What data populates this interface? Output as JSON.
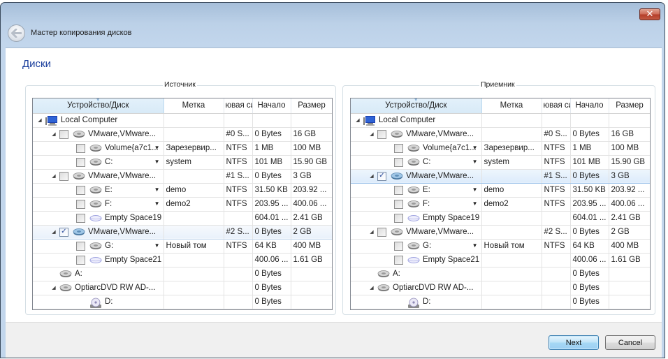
{
  "window": {
    "title": "Мастер копирования дисков",
    "close_icon": "close-x-icon",
    "back_icon": "back-arrow-icon"
  },
  "page": {
    "heading": "Диски"
  },
  "columns": [
    "Устройство/Диск",
    "Метка",
    "ювая си",
    "Начало",
    "Размер"
  ],
  "source": {
    "label": "Источник",
    "rows": [
      {
        "level": 0,
        "expander": true,
        "checkbox": false,
        "checked": false,
        "icon": "computer-icon",
        "name": "Local Computer",
        "dropdown": false,
        "label": "",
        "fs": "",
        "start": "",
        "size": "",
        "selected": false
      },
      {
        "level": 1,
        "expander": true,
        "checkbox": true,
        "checked": false,
        "icon": "hard-disk-icon",
        "name": "VMware,VMware...",
        "dropdown": false,
        "label": "",
        "fs": "#0 S...",
        "start": "0 Bytes",
        "size": "16 GB",
        "selected": false
      },
      {
        "level": 2,
        "expander": false,
        "checkbox": true,
        "checked": false,
        "icon": "hard-disk-icon",
        "name": "Volume{a7c1...",
        "dropdown": true,
        "label": "Зарезервир...",
        "fs": "NTFS",
        "start": "1 MB",
        "size": "100 MB",
        "selected": false
      },
      {
        "level": 2,
        "expander": false,
        "checkbox": true,
        "checked": false,
        "icon": "hard-disk-icon",
        "name": "C:",
        "dropdown": true,
        "label": "system",
        "fs": "NTFS",
        "start": "101 MB",
        "size": "15.90 GB",
        "selected": false
      },
      {
        "level": 1,
        "expander": true,
        "checkbox": true,
        "checked": false,
        "icon": "hard-disk-icon",
        "name": "VMware,VMware...",
        "dropdown": false,
        "label": "",
        "fs": "#1 S...",
        "start": "0 Bytes",
        "size": "3 GB",
        "selected": false
      },
      {
        "level": 2,
        "expander": false,
        "checkbox": true,
        "checked": false,
        "icon": "hard-disk-icon",
        "name": "E:",
        "dropdown": true,
        "label": "demo",
        "fs": "NTFS",
        "start": "31.50 KB",
        "size": "203.92 ...",
        "selected": false
      },
      {
        "level": 2,
        "expander": false,
        "checkbox": true,
        "checked": false,
        "icon": "hard-disk-icon",
        "name": "F:",
        "dropdown": true,
        "label": "demo2",
        "fs": "NTFS",
        "start": "203.95 ...",
        "size": "400.06 ...",
        "selected": false
      },
      {
        "level": 2,
        "expander": false,
        "checkbox": true,
        "checked": false,
        "icon": "empty-space-icon",
        "name": "Empty Space19",
        "dropdown": false,
        "label": "",
        "fs": "",
        "start": "604.01 ...",
        "size": "2.41 GB",
        "selected": false
      },
      {
        "level": 1,
        "expander": true,
        "checkbox": true,
        "checked": true,
        "icon": "hard-disk-selected-icon",
        "name": "VMware,VMware...",
        "dropdown": false,
        "label": "",
        "fs": "#2 S...",
        "start": "0 Bytes",
        "size": "2 GB",
        "selected": true
      },
      {
        "level": 2,
        "expander": false,
        "checkbox": true,
        "checked": false,
        "icon": "hard-disk-icon",
        "name": "G:",
        "dropdown": true,
        "label": "Новый том",
        "fs": "NTFS",
        "start": "64 KB",
        "size": "400 MB",
        "selected": false
      },
      {
        "level": 2,
        "expander": false,
        "checkbox": true,
        "checked": false,
        "icon": "empty-space-icon",
        "name": "Empty Space21",
        "dropdown": false,
        "label": "",
        "fs": "",
        "start": "400.06 ...",
        "size": "1.61 GB",
        "selected": false
      },
      {
        "level": 1,
        "expander": false,
        "checkbox": false,
        "checked": false,
        "icon": "hard-disk-icon",
        "name": "A:",
        "dropdown": false,
        "label": "",
        "fs": "",
        "start": "0 Bytes",
        "size": "",
        "selected": false
      },
      {
        "level": 1,
        "expander": true,
        "checkbox": false,
        "checked": false,
        "icon": "hard-disk-icon",
        "name": "OptiarcDVD RW AD-...",
        "dropdown": false,
        "label": "",
        "fs": "",
        "start": "0 Bytes",
        "size": "",
        "selected": false
      },
      {
        "level": 2,
        "expander": false,
        "checkbox": false,
        "checked": false,
        "icon": "optical-drive-icon",
        "name": "D:",
        "dropdown": false,
        "label": "",
        "fs": "",
        "start": "0 Bytes",
        "size": "",
        "selected": false
      }
    ]
  },
  "target": {
    "label": "Приемник",
    "rows": [
      {
        "level": 0,
        "expander": true,
        "checkbox": false,
        "checked": false,
        "icon": "computer-icon",
        "name": "Local Computer",
        "dropdown": false,
        "label": "",
        "fs": "",
        "start": "",
        "size": "",
        "selected": false
      },
      {
        "level": 1,
        "expander": true,
        "checkbox": true,
        "checked": false,
        "icon": "hard-disk-icon",
        "name": "VMware,VMware...",
        "dropdown": false,
        "label": "",
        "fs": "#0 S...",
        "start": "0 Bytes",
        "size": "16 GB",
        "selected": false
      },
      {
        "level": 2,
        "expander": false,
        "checkbox": true,
        "checked": false,
        "icon": "hard-disk-icon",
        "name": "Volume{a7c1...",
        "dropdown": true,
        "label": "Зарезервир...",
        "fs": "NTFS",
        "start": "1 MB",
        "size": "100 MB",
        "selected": false
      },
      {
        "level": 2,
        "expander": false,
        "checkbox": true,
        "checked": false,
        "icon": "hard-disk-icon",
        "name": "C:",
        "dropdown": true,
        "label": "system",
        "fs": "NTFS",
        "start": "101 MB",
        "size": "15.90 GB",
        "selected": false
      },
      {
        "level": 1,
        "expander": true,
        "checkbox": true,
        "checked": true,
        "icon": "hard-disk-selected-icon",
        "name": "VMware,VMware...",
        "dropdown": false,
        "label": "",
        "fs": "#1 S...",
        "start": "0 Bytes",
        "size": "3 GB",
        "selected": true
      },
      {
        "level": 2,
        "expander": false,
        "checkbox": true,
        "checked": false,
        "icon": "hard-disk-icon",
        "name": "E:",
        "dropdown": true,
        "label": "demo",
        "fs": "NTFS",
        "start": "31.50 KB",
        "size": "203.92 ...",
        "selected": false
      },
      {
        "level": 2,
        "expander": false,
        "checkbox": true,
        "checked": false,
        "icon": "hard-disk-icon",
        "name": "F:",
        "dropdown": true,
        "label": "demo2",
        "fs": "NTFS",
        "start": "203.95 ...",
        "size": "400.06 ...",
        "selected": false
      },
      {
        "level": 2,
        "expander": false,
        "checkbox": true,
        "checked": false,
        "icon": "empty-space-icon",
        "name": "Empty Space19",
        "dropdown": false,
        "label": "",
        "fs": "",
        "start": "604.01 ...",
        "size": "2.41 GB",
        "selected": false
      },
      {
        "level": 1,
        "expander": true,
        "checkbox": true,
        "checked": false,
        "icon": "hard-disk-icon",
        "name": "VMware,VMware...",
        "dropdown": false,
        "label": "",
        "fs": "#2 S...",
        "start": "0 Bytes",
        "size": "2 GB",
        "selected": false
      },
      {
        "level": 2,
        "expander": false,
        "checkbox": true,
        "checked": false,
        "icon": "hard-disk-icon",
        "name": "G:",
        "dropdown": true,
        "label": "Новый том",
        "fs": "NTFS",
        "start": "64 KB",
        "size": "400 MB",
        "selected": false
      },
      {
        "level": 2,
        "expander": false,
        "checkbox": true,
        "checked": false,
        "icon": "empty-space-icon",
        "name": "Empty Space21",
        "dropdown": false,
        "label": "",
        "fs": "",
        "start": "400.06 ...",
        "size": "1.61 GB",
        "selected": false
      },
      {
        "level": 1,
        "expander": false,
        "checkbox": false,
        "checked": false,
        "icon": "hard-disk-icon",
        "name": "A:",
        "dropdown": false,
        "label": "",
        "fs": "",
        "start": "0 Bytes",
        "size": "",
        "selected": false
      },
      {
        "level": 1,
        "expander": true,
        "checkbox": false,
        "checked": false,
        "icon": "hard-disk-icon",
        "name": "OptiarcDVD RW AD-...",
        "dropdown": false,
        "label": "",
        "fs": "",
        "start": "0 Bytes",
        "size": "",
        "selected": false
      },
      {
        "level": 2,
        "expander": false,
        "checkbox": false,
        "checked": false,
        "icon": "optical-drive-icon",
        "name": "D:",
        "dropdown": false,
        "label": "",
        "fs": "",
        "start": "0 Bytes",
        "size": "",
        "selected": false
      }
    ]
  },
  "buttons": {
    "next": "Next",
    "cancel": "Cancel"
  },
  "colors": {
    "heading": "#1a3e9c",
    "selection": "#dcebfb",
    "titlebar": "#bcd1e8"
  }
}
